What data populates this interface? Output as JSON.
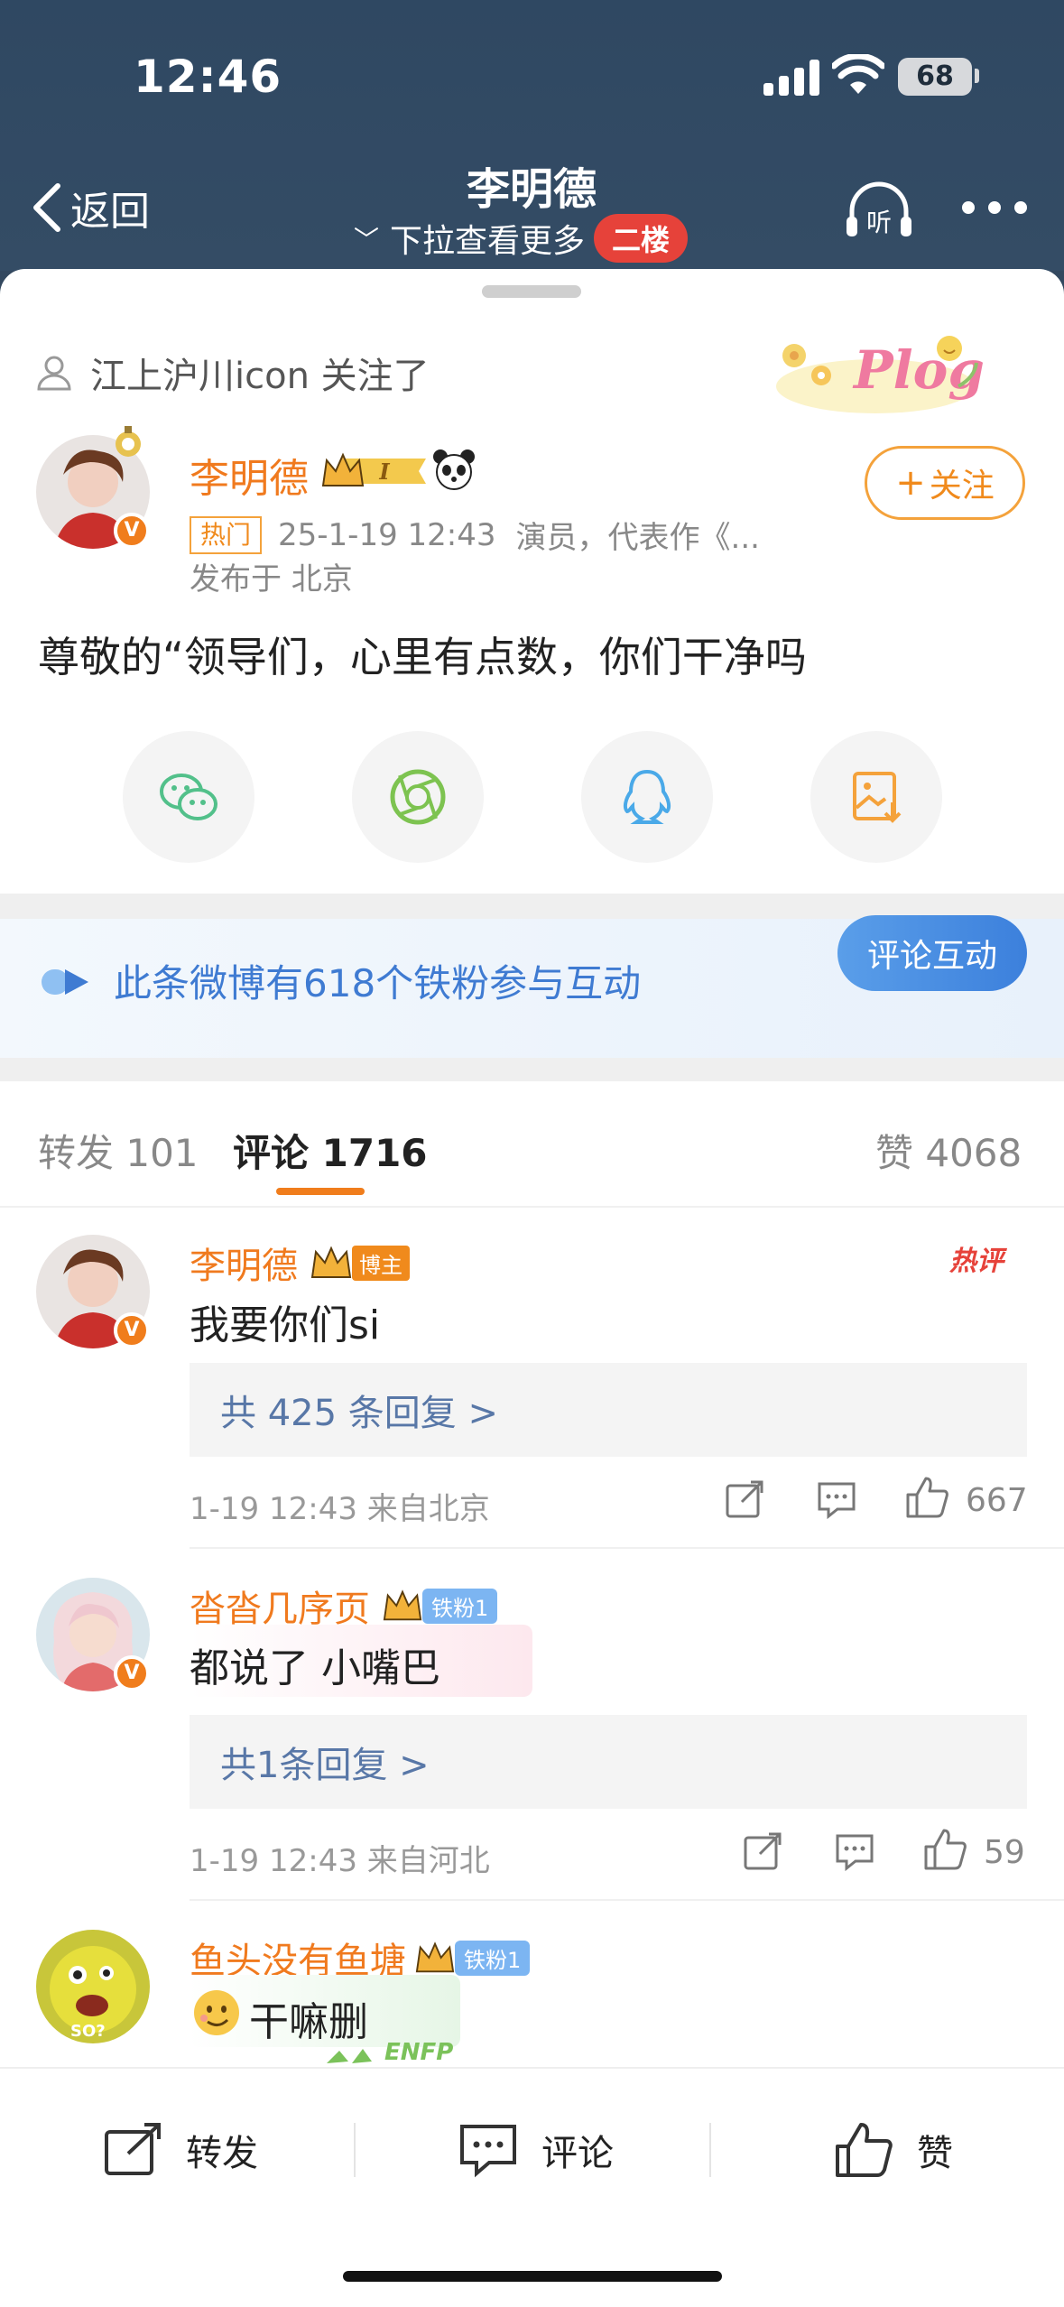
{
  "status_bar": {
    "time": "12:46",
    "battery": "68"
  },
  "nav": {
    "back_label": "返回",
    "title": "李明德",
    "subtitle": "下拉查看更多",
    "floor_badge": "二楼",
    "listen_label": "听"
  },
  "follow_note": "江上沪川icon 关注了",
  "post": {
    "author": "李明德",
    "level_badge": "I",
    "follow_button": "关注",
    "hot_tag": "热门",
    "time": "25-1-19 12:43",
    "bio": "演员，代表作《...",
    "location": "发布于 北京",
    "text": "尊敬的“领导们，心里有点数，你们干净吗"
  },
  "share_icons": [
    "wechat-icon",
    "moments-icon",
    "qq-icon",
    "save-image-icon"
  ],
  "fan_banner": {
    "text": "此条微博有618个铁粉参与互动",
    "button": "评论互动"
  },
  "tabs": {
    "repost": "转发 101",
    "comments": "评论 1716",
    "likes": "赞 4068"
  },
  "comments": [
    {
      "name": "李明德",
      "tag": "博主",
      "text": "我要你们si",
      "replies": "共 425 条回复 >",
      "meta": "1-19 12:43  来自北京",
      "likes": "667",
      "hot_label": "热评"
    },
    {
      "name": "沓沓几序页",
      "tag": "铁粉1",
      "text": "都说了 小嘴巴",
      "replies": "共1条回复 >",
      "meta": "1-19 12:43  来自河北",
      "likes": "59"
    },
    {
      "name": "鱼头没有鱼塘",
      "tag": "铁粉1",
      "text": "干嘛删",
      "sticker_text": "ENFP"
    }
  ],
  "bottom_bar": {
    "repost": "转发",
    "comment": "评论",
    "like": "赞"
  },
  "colors": {
    "header_bg": "#33485f",
    "accent_orange": "#f07a1e",
    "link_blue": "#3f7bd2",
    "hot_red": "#e6423a"
  }
}
